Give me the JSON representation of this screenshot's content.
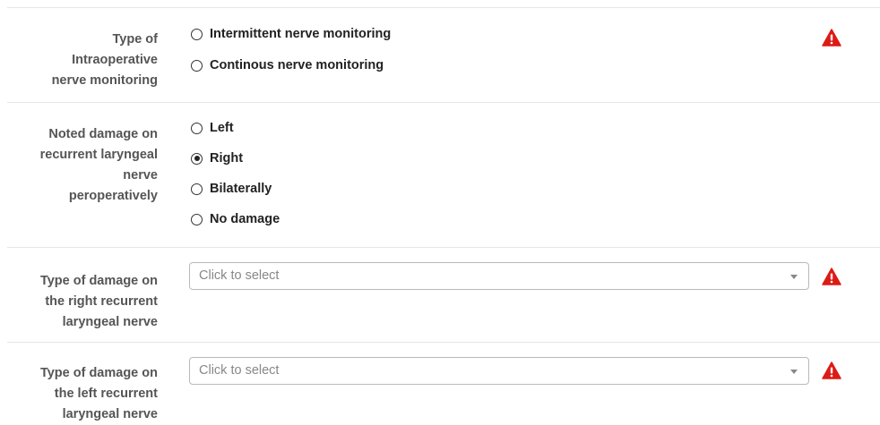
{
  "colors": {
    "warning": "#dd1b16",
    "divider": "#e6e6e6",
    "label": "#555555"
  },
  "icons": {
    "warning": "exclamation-triangle-icon",
    "dropdown": "caret-down-icon"
  },
  "fields": {
    "monitoring_type": {
      "label": [
        "Type of",
        "Intraoperative",
        "nerve monitoring"
      ],
      "options": [
        {
          "label": "Intermittent nerve monitoring",
          "checked": false
        },
        {
          "label": "Continous nerve monitoring",
          "checked": false
        }
      ]
    },
    "noted_damage": {
      "label": [
        "Noted damage on",
        "recurrent laryngeal",
        "nerve",
        "peroperatively"
      ],
      "options": [
        {
          "label": "Left",
          "checked": false
        },
        {
          "label": "Right",
          "checked": true
        },
        {
          "label": "Bilaterally",
          "checked": false
        },
        {
          "label": "No damage",
          "checked": false
        }
      ]
    },
    "right_damage_type": {
      "label": [
        "Type of damage on",
        "the right recurrent",
        "laryngeal nerve"
      ],
      "placeholder": "Click to select"
    },
    "left_damage_type": {
      "label": [
        "Type of damage on",
        "the left recurrent",
        "laryngeal nerve"
      ],
      "placeholder": "Click to select"
    }
  }
}
